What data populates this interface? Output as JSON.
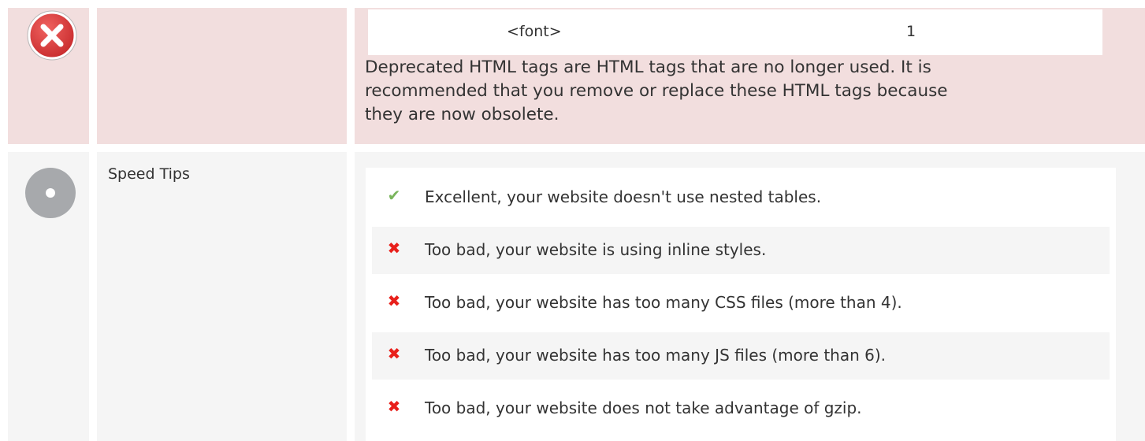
{
  "deprecated": {
    "status_icon": "error-x-icon",
    "label": "",
    "tags": [
      {
        "tag": "<font>",
        "count": "1"
      }
    ],
    "description": "Deprecated HTML tags are HTML tags that are no longer used. It is recommended that you remove or replace these HTML tags because they are now obsolete."
  },
  "speed": {
    "status_icon": "neutral-dot-icon",
    "label": "Speed Tips",
    "tips": [
      {
        "status": "ok",
        "icon": "checkmark-icon",
        "text": "Excellent, your website doesn't use nested tables."
      },
      {
        "status": "bad",
        "icon": "cross-icon",
        "text": "Too bad, your website is using inline styles."
      },
      {
        "status": "bad",
        "icon": "cross-icon",
        "text": "Too bad, your website has too many CSS files (more than 4)."
      },
      {
        "status": "bad",
        "icon": "cross-icon",
        "text": "Too bad, your website has too many JS files (more than 6)."
      },
      {
        "status": "bad",
        "icon": "cross-icon",
        "text": "Too bad, your website does not take advantage of gzip."
      }
    ]
  },
  "colors": {
    "error_bg": "#f2dede",
    "neutral_bg": "#f5f5f5",
    "ok": "#7ab55c",
    "bad": "#e8201b",
    "error_icon": "#d9373a"
  }
}
